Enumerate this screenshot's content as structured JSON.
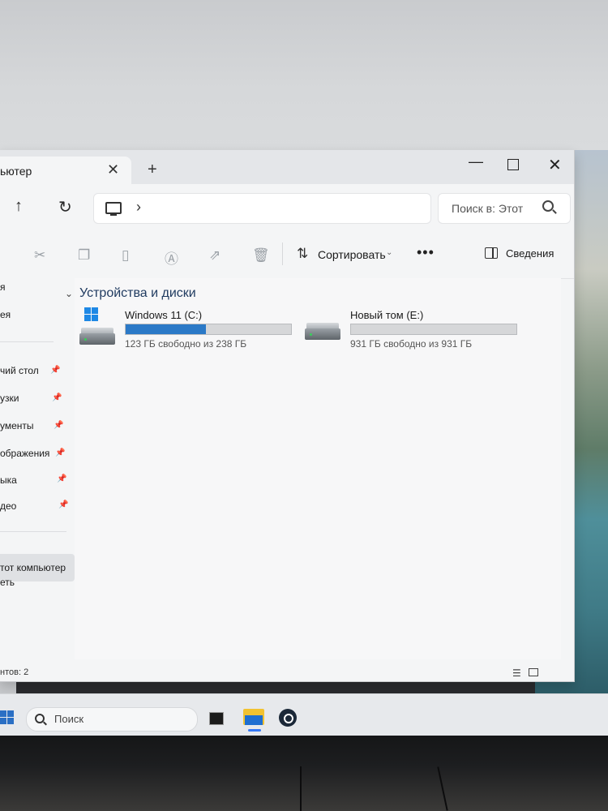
{
  "window": {
    "tab_title": "ьютер",
    "title_buttons": {
      "new_tab": "+",
      "close_tab": "✕",
      "minimize": "—",
      "close": "✕"
    }
  },
  "address": {
    "breadcrumb_chevron": "›",
    "search_placeholder": "Поиск в: Этот"
  },
  "toolbar": {
    "sort_label": "Сортировать",
    "more_label": "•••",
    "details_label": "Сведения"
  },
  "sidebar": {
    "items": [
      {
        "label": "я"
      },
      {
        "label": "ея"
      },
      {
        "label": "чий стол",
        "pinned": true
      },
      {
        "label": "узки",
        "pinned": true
      },
      {
        "label": "ументы",
        "pinned": true
      },
      {
        "label": "ображения",
        "pinned": true
      },
      {
        "label": "ыка",
        "pinned": true
      },
      {
        "label": "део",
        "pinned": true
      },
      {
        "label": "тот компьютер",
        "selected": true
      },
      {
        "label": "еть"
      }
    ]
  },
  "content": {
    "group_title": "Устройства и диски",
    "drives": [
      {
        "name": "Windows 11 (C:)",
        "free_text": "123 ГБ свободно из 238 ГБ",
        "used_fraction": 0.483
      },
      {
        "name": "Новый том (E:)",
        "free_text": "931 ГБ свободно из 931 ГБ",
        "used_fraction": 0.0
      }
    ]
  },
  "status": {
    "items_text": "нтов: 2"
  },
  "taskbar": {
    "search_placeholder": "Поиск"
  },
  "colors": {
    "accent": "#2b79c7",
    "window_bg": "#f4f5f6"
  }
}
